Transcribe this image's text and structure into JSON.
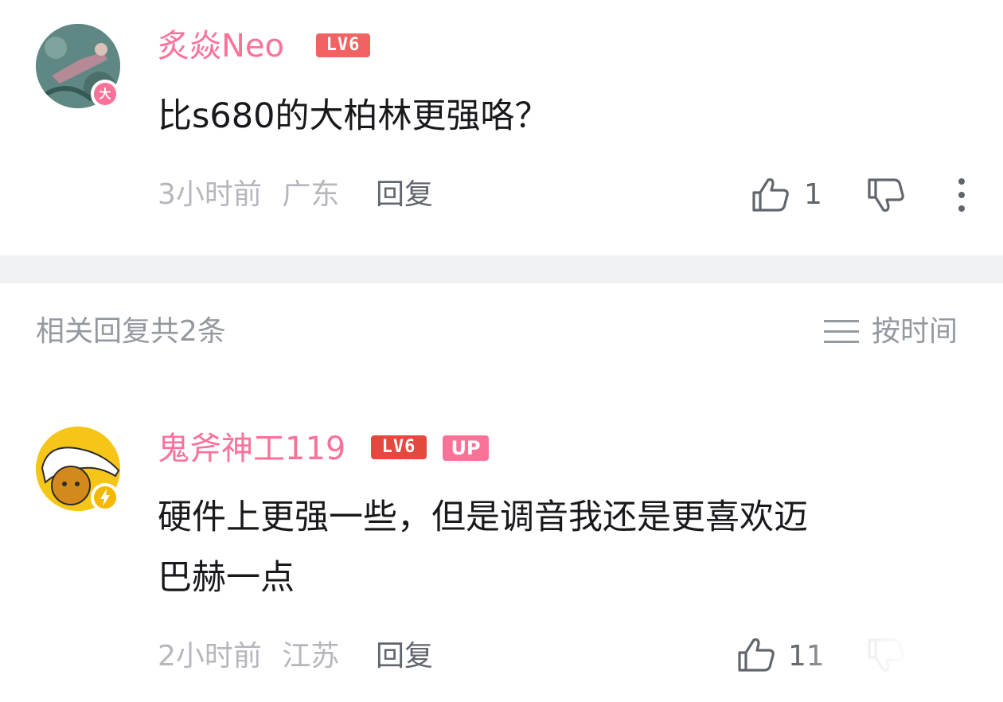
{
  "comment": {
    "username": "炙焱Neo",
    "level_badge": "LV6",
    "avatar_badge": "大",
    "text": "比s680的大柏林更强咯？",
    "time": "3小时前",
    "location": "广东",
    "reply_label": "回复",
    "like_count": "1"
  },
  "replies_header": {
    "title": "相关回复共2条",
    "sort_label": "按时间"
  },
  "reply": {
    "username": "鬼斧神工119",
    "level_badge": "LV6",
    "up_badge": "UP",
    "text_line1": "硬件上更强一些，但是调音我还是更喜欢迈",
    "text_line2": "巴赫一点",
    "time": "2小时前",
    "location": "江苏",
    "reply_label": "回复",
    "like_count": "11"
  },
  "colors": {
    "username": "#fb7299",
    "level_badge": "#f16262",
    "meta_text": "#b5b7bd",
    "divider": "#f1f2f3"
  },
  "icons": [
    "like-icon",
    "dislike-icon",
    "more-icon",
    "sort-icon",
    "lightning-icon"
  ]
}
